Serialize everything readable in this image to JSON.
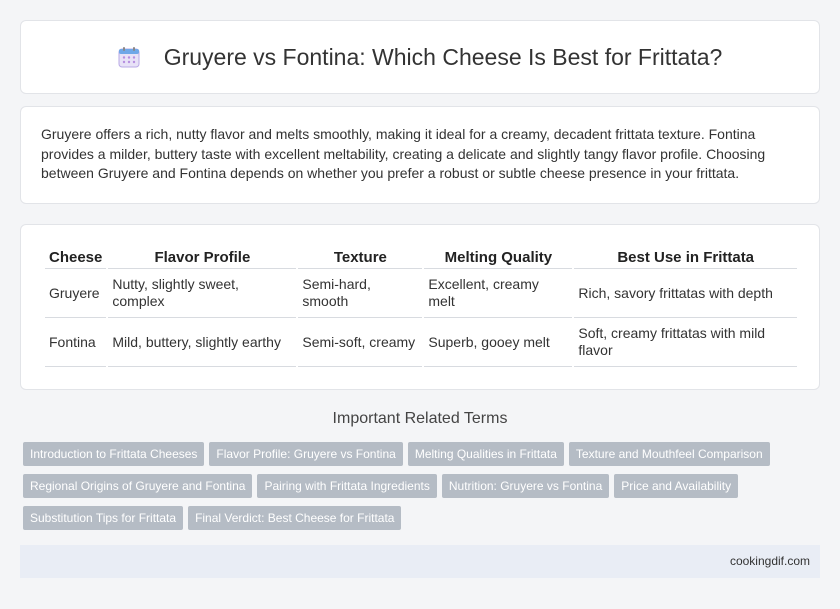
{
  "header": {
    "title": "Gruyere vs Fontina: Which Cheese Is Best for Frittata?",
    "icon": "calendar-icon"
  },
  "intro": {
    "text": "Gruyere offers a rich, nutty flavor and melts smoothly, making it ideal for a creamy, decadent frittata texture. Fontina provides a milder, buttery taste with excellent meltability, creating a delicate and slightly tangy flavor profile. Choosing between Gruyere and Fontina depends on whether you prefer a robust or subtle cheese presence in your frittata."
  },
  "table": {
    "headers": [
      "Cheese",
      "Flavor Profile",
      "Texture",
      "Melting Quality",
      "Best Use in Frittata"
    ],
    "rows": [
      [
        "Gruyere",
        "Nutty, slightly sweet, complex",
        "Semi-hard, smooth",
        "Excellent, creamy melt",
        "Rich, savory frittatas with depth"
      ],
      [
        "Fontina",
        "Mild, buttery, slightly earthy",
        "Semi-soft, creamy",
        "Superb, gooey melt",
        "Soft, creamy frittatas with mild flavor"
      ]
    ]
  },
  "related": {
    "title": "Important Related Terms",
    "tags": [
      "Introduction to Frittata Cheeses",
      "Flavor Profile: Gruyere vs Fontina",
      "Melting Qualities in Frittata",
      "Texture and Mouthfeel Comparison",
      "Regional Origins of Gruyere and Fontina",
      "Pairing with Frittata Ingredients",
      "Nutrition: Gruyere vs Fontina",
      "Price and Availability",
      "Substitution Tips for Frittata",
      "Final Verdict: Best Cheese for Frittata"
    ]
  },
  "footer": {
    "site": "cookingdif.com"
  }
}
